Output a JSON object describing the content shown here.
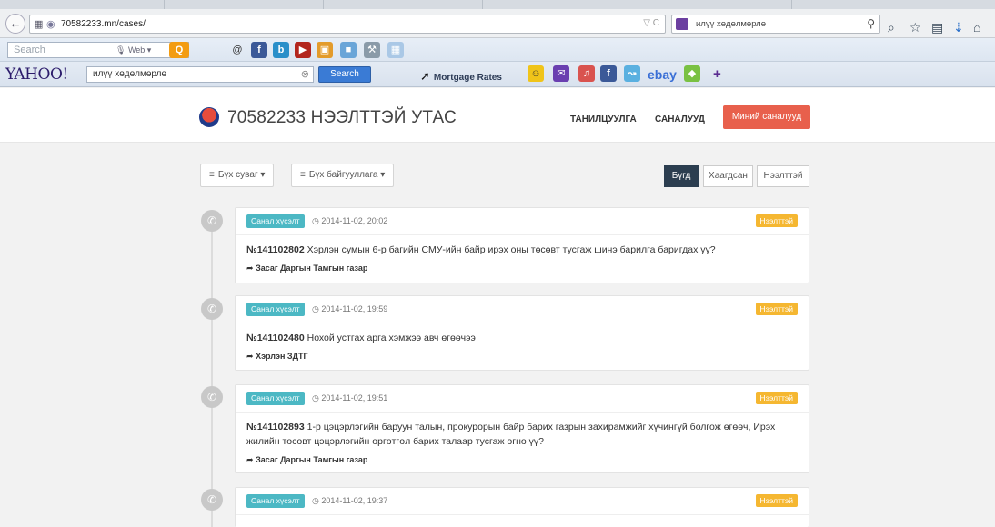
{
  "browser": {
    "url": "70582233.mn/cases/",
    "search_text": "илүү хөдөлмөрлө",
    "yahoo_toolbar": {
      "search_placeholder": "Search",
      "web_label": "Web",
      "logo": "YAHOO!",
      "query": "илүү хөдөлмөрлө",
      "search_button": "Search",
      "mortgage_label": "Mortgage Rates",
      "ebay_label": "ebay"
    }
  },
  "site": {
    "title": "70582233 НЭЭЛТТЭЙ УТАС",
    "nav": {
      "intro": "ТАНИЛЦУУЛГА",
      "proposals": "САНАЛУУД",
      "my_proposals": "Миний саналууд"
    },
    "filters": {
      "channel": "Бүх суваг",
      "organization": "Бүх байгууллага"
    },
    "segments": {
      "all": "Бүгд",
      "closed": "Хаагдсан",
      "open": "Нээлттэй"
    }
  },
  "cases": [
    {
      "label": "Санал хүсэлт",
      "time": "2014-11-02, 20:02",
      "status": "Нээлттэй",
      "number": "№141102802",
      "text": "Хэрлэн сумын 6-р багийн СМУ-ийн байр ирэх оны төсөвт тусгаж шинэ барилга баригдах уу?",
      "org": "Засаг Даргын Тамгын газар"
    },
    {
      "label": "Санал хүсэлт",
      "time": "2014-11-02, 19:59",
      "status": "Нээлттэй",
      "number": "№141102480",
      "text": "Нохой устгах арга хэмжээ авч өгөөчээ",
      "org": "Хэрлэн ЗДТГ"
    },
    {
      "label": "Санал хүсэлт",
      "time": "2014-11-02, 19:51",
      "status": "Нээлттэй",
      "number": "№141102893",
      "text": "1-р цэцэрлэгийн баруун талын, прокурорын байр барих газрын захирамжийг хүчингүй болгож өгөөч, Ирэх жилийн төсөвт цэцэрлэгийн өргөтгөл барих талаар тусгаж өгнө үү?",
      "org": "Засаг Даргын Тамгын газар"
    },
    {
      "label": "Санал хүсэлт",
      "time": "2014-11-02, 19:37",
      "status": "Нээлттэй"
    }
  ],
  "colors": {
    "accent_red": "#e8604c",
    "label_teal": "#4cb8c4",
    "status_yellow": "#f5b731",
    "segment_dark": "#2c3e50"
  }
}
